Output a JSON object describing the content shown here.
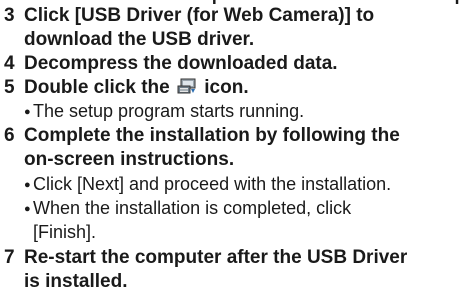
{
  "top_partial": {
    "left_bracket": "[",
    "right_bracket": "]"
  },
  "steps": [
    {
      "number": "3",
      "line1": "Click [USB Driver (for Web Camera)] to",
      "line2": "download the USB driver."
    },
    {
      "number": "4",
      "line1": "Decompress the downloaded data."
    },
    {
      "number": "5",
      "before_icon": "Double click the",
      "icon": "installer-icon",
      "after_icon": "icon.",
      "bullets": [
        {
          "line1": "The setup program starts running."
        }
      ]
    },
    {
      "number": "6",
      "line1": "Complete the installation by following the",
      "line2": "on-screen instructions.",
      "bullets": [
        {
          "line1": "Click [Next] and proceed with the installation."
        },
        {
          "line1": "When the installation is completed, click",
          "line2": "[Finish]."
        }
      ]
    },
    {
      "number": "7",
      "line1": "Re-start the computer after the USB Driver",
      "line2": "is installed."
    }
  ]
}
